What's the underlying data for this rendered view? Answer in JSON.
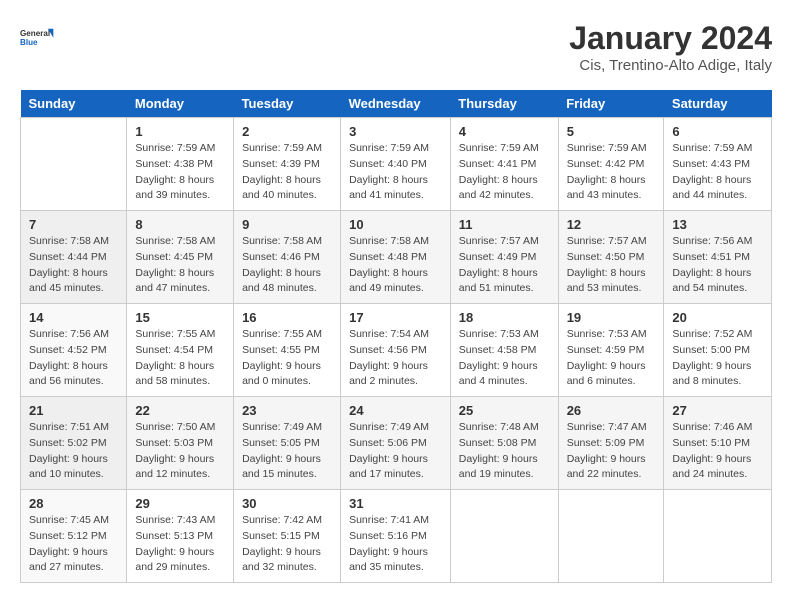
{
  "header": {
    "logo_line1": "General",
    "logo_line2": "Blue",
    "title": "January 2024",
    "subtitle": "Cis, Trentino-Alto Adige, Italy"
  },
  "days_of_week": [
    "Sunday",
    "Monday",
    "Tuesday",
    "Wednesday",
    "Thursday",
    "Friday",
    "Saturday"
  ],
  "weeks": [
    [
      {
        "day": "",
        "info": ""
      },
      {
        "day": "1",
        "info": "Sunrise: 7:59 AM\nSunset: 4:38 PM\nDaylight: 8 hours\nand 39 minutes."
      },
      {
        "day": "2",
        "info": "Sunrise: 7:59 AM\nSunset: 4:39 PM\nDaylight: 8 hours\nand 40 minutes."
      },
      {
        "day": "3",
        "info": "Sunrise: 7:59 AM\nSunset: 4:40 PM\nDaylight: 8 hours\nand 41 minutes."
      },
      {
        "day": "4",
        "info": "Sunrise: 7:59 AM\nSunset: 4:41 PM\nDaylight: 8 hours\nand 42 minutes."
      },
      {
        "day": "5",
        "info": "Sunrise: 7:59 AM\nSunset: 4:42 PM\nDaylight: 8 hours\nand 43 minutes."
      },
      {
        "day": "6",
        "info": "Sunrise: 7:59 AM\nSunset: 4:43 PM\nDaylight: 8 hours\nand 44 minutes."
      }
    ],
    [
      {
        "day": "7",
        "info": "Sunrise: 7:58 AM\nSunset: 4:44 PM\nDaylight: 8 hours\nand 45 minutes."
      },
      {
        "day": "8",
        "info": "Sunrise: 7:58 AM\nSunset: 4:45 PM\nDaylight: 8 hours\nand 47 minutes."
      },
      {
        "day": "9",
        "info": "Sunrise: 7:58 AM\nSunset: 4:46 PM\nDaylight: 8 hours\nand 48 minutes."
      },
      {
        "day": "10",
        "info": "Sunrise: 7:58 AM\nSunset: 4:48 PM\nDaylight: 8 hours\nand 49 minutes."
      },
      {
        "day": "11",
        "info": "Sunrise: 7:57 AM\nSunset: 4:49 PM\nDaylight: 8 hours\nand 51 minutes."
      },
      {
        "day": "12",
        "info": "Sunrise: 7:57 AM\nSunset: 4:50 PM\nDaylight: 8 hours\nand 53 minutes."
      },
      {
        "day": "13",
        "info": "Sunrise: 7:56 AM\nSunset: 4:51 PM\nDaylight: 8 hours\nand 54 minutes."
      }
    ],
    [
      {
        "day": "14",
        "info": "Sunrise: 7:56 AM\nSunset: 4:52 PM\nDaylight: 8 hours\nand 56 minutes."
      },
      {
        "day": "15",
        "info": "Sunrise: 7:55 AM\nSunset: 4:54 PM\nDaylight: 8 hours\nand 58 minutes."
      },
      {
        "day": "16",
        "info": "Sunrise: 7:55 AM\nSunset: 4:55 PM\nDaylight: 9 hours\nand 0 minutes."
      },
      {
        "day": "17",
        "info": "Sunrise: 7:54 AM\nSunset: 4:56 PM\nDaylight: 9 hours\nand 2 minutes."
      },
      {
        "day": "18",
        "info": "Sunrise: 7:53 AM\nSunset: 4:58 PM\nDaylight: 9 hours\nand 4 minutes."
      },
      {
        "day": "19",
        "info": "Sunrise: 7:53 AM\nSunset: 4:59 PM\nDaylight: 9 hours\nand 6 minutes."
      },
      {
        "day": "20",
        "info": "Sunrise: 7:52 AM\nSunset: 5:00 PM\nDaylight: 9 hours\nand 8 minutes."
      }
    ],
    [
      {
        "day": "21",
        "info": "Sunrise: 7:51 AM\nSunset: 5:02 PM\nDaylight: 9 hours\nand 10 minutes."
      },
      {
        "day": "22",
        "info": "Sunrise: 7:50 AM\nSunset: 5:03 PM\nDaylight: 9 hours\nand 12 minutes."
      },
      {
        "day": "23",
        "info": "Sunrise: 7:49 AM\nSunset: 5:05 PM\nDaylight: 9 hours\nand 15 minutes."
      },
      {
        "day": "24",
        "info": "Sunrise: 7:49 AM\nSunset: 5:06 PM\nDaylight: 9 hours\nand 17 minutes."
      },
      {
        "day": "25",
        "info": "Sunrise: 7:48 AM\nSunset: 5:08 PM\nDaylight: 9 hours\nand 19 minutes."
      },
      {
        "day": "26",
        "info": "Sunrise: 7:47 AM\nSunset: 5:09 PM\nDaylight: 9 hours\nand 22 minutes."
      },
      {
        "day": "27",
        "info": "Sunrise: 7:46 AM\nSunset: 5:10 PM\nDaylight: 9 hours\nand 24 minutes."
      }
    ],
    [
      {
        "day": "28",
        "info": "Sunrise: 7:45 AM\nSunset: 5:12 PM\nDaylight: 9 hours\nand 27 minutes."
      },
      {
        "day": "29",
        "info": "Sunrise: 7:43 AM\nSunset: 5:13 PM\nDaylight: 9 hours\nand 29 minutes."
      },
      {
        "day": "30",
        "info": "Sunrise: 7:42 AM\nSunset: 5:15 PM\nDaylight: 9 hours\nand 32 minutes."
      },
      {
        "day": "31",
        "info": "Sunrise: 7:41 AM\nSunset: 5:16 PM\nDaylight: 9 hours\nand 35 minutes."
      },
      {
        "day": "",
        "info": ""
      },
      {
        "day": "",
        "info": ""
      },
      {
        "day": "",
        "info": ""
      }
    ]
  ]
}
